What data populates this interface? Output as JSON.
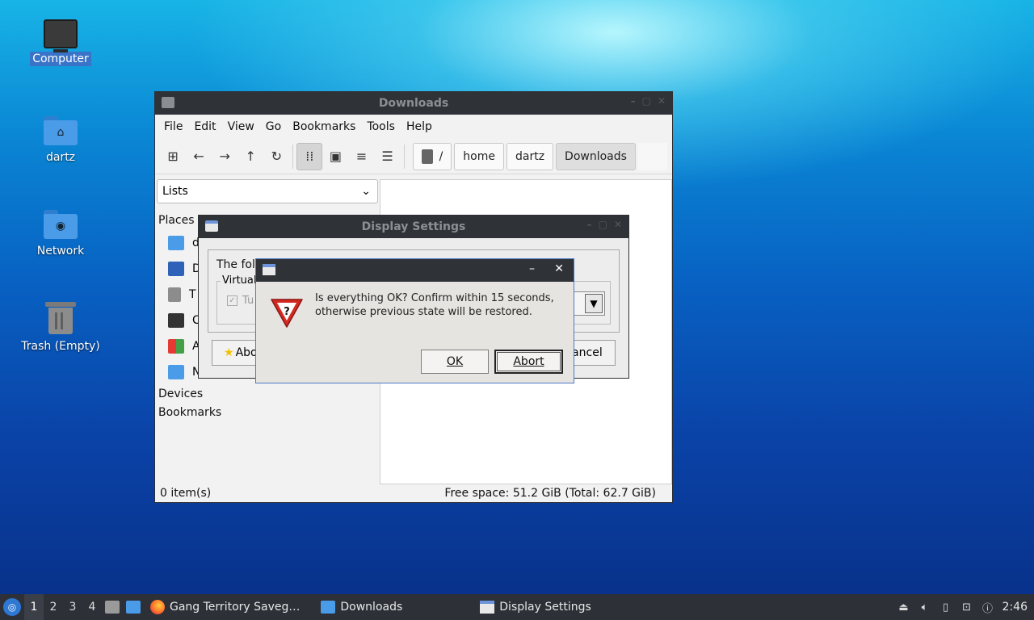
{
  "desktop": {
    "icons": [
      {
        "label": "Computer",
        "icon": "computer-icon"
      },
      {
        "label": "dartz",
        "icon": "home-folder-icon"
      },
      {
        "label": "Network",
        "icon": "network-folder-icon"
      },
      {
        "label": "Trash (Empty)",
        "icon": "trash-icon"
      }
    ]
  },
  "file_manager": {
    "title": "Downloads",
    "menu": [
      "File",
      "Edit",
      "View",
      "Go",
      "Bookmarks",
      "Tools",
      "Help"
    ],
    "path": [
      "/",
      "home",
      "dartz",
      "Downloads"
    ],
    "side_select": "Lists",
    "sections": {
      "places": "Places",
      "devices": "Devices",
      "bookmarks": "Bookmarks"
    },
    "places_items": [
      "d",
      "D",
      "T",
      "C",
      "A",
      "N"
    ],
    "status_left": "0 item(s)",
    "status_right": "Free space: 51.2 GiB (Total: 62.7 GiB)"
  },
  "display_settings": {
    "title": "Display Settings",
    "text": "The foll",
    "group_title": "Virtual",
    "check_label": "Tu",
    "about_label": "Abo",
    "cancel_label": "Cancel"
  },
  "confirm": {
    "message_line1": "Is everything OK? Confirm within 15 seconds,",
    "message_line2": "otherwise previous state will be restored.",
    "ok_label": "OK",
    "abort_label": "Abort"
  },
  "taskbar": {
    "workspaces": [
      "1",
      "2",
      "3",
      "4"
    ],
    "current_workspace": "1",
    "tasks": [
      {
        "label": "Gang Territory Saveg…",
        "icon": "firefox-icon"
      },
      {
        "label": "Downloads",
        "icon": "folder-icon"
      },
      {
        "label": "Display Settings",
        "icon": "window-icon"
      }
    ],
    "clock": "2:46"
  },
  "colors": {
    "titlebar": "#2f3237",
    "taskbar": "#2d3037",
    "selection": "#3a74c8",
    "accent_border": "#4d79c8"
  }
}
